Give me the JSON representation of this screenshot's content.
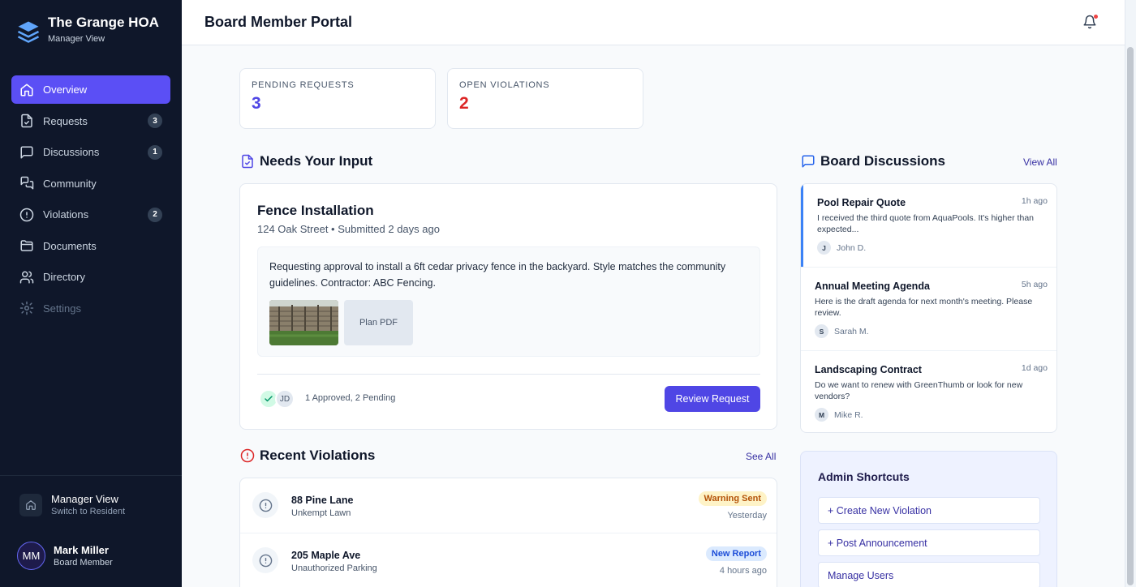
{
  "brand": {
    "name": "The Grange HOA",
    "subtitle": "Manager View"
  },
  "sidebar": {
    "items": [
      {
        "label": "Overview",
        "icon": "home-icon",
        "active": true
      },
      {
        "label": "Requests",
        "icon": "file-check-icon",
        "badge": "3"
      },
      {
        "label": "Discussions",
        "icon": "chat-icon",
        "badge": "1"
      },
      {
        "label": "Community",
        "icon": "messages-icon"
      },
      {
        "label": "Violations",
        "icon": "alert-circle-icon",
        "badge": "2"
      },
      {
        "label": "Documents",
        "icon": "folder-icon"
      },
      {
        "label": "Directory",
        "icon": "users-icon"
      },
      {
        "label": "Settings",
        "icon": "gear-icon",
        "disabled": true
      }
    ],
    "switch_view": {
      "title": "Manager View",
      "subtitle": "Switch to Resident"
    },
    "user": {
      "initials": "MM",
      "name": "Mark Miller",
      "role": "Board Member"
    }
  },
  "header": {
    "title": "Board Member Portal"
  },
  "stats": {
    "pending": {
      "label": "PENDING REQUESTS",
      "value": "3"
    },
    "violations": {
      "label": "OPEN VIOLATIONS",
      "value": "2"
    }
  },
  "needs_input": {
    "heading": "Needs Your Input",
    "request": {
      "title": "Fence Installation",
      "meta": "124 Oak Street • Submitted 2 days ago",
      "description": "Requesting approval to install a 6ft cedar privacy fence in the backyard. Style matches the community guidelines. Contractor: ABC Fencing.",
      "attachment_label": "Plan PDF",
      "voter_initials": "JD",
      "vote_summary": "1 Approved, 2 Pending",
      "review_label": "Review Request"
    }
  },
  "violations": {
    "heading": "Recent Violations",
    "see_all": "See All",
    "items": [
      {
        "address": "88 Pine Lane",
        "type": "Unkempt Lawn",
        "badge": "Warning Sent",
        "time": "Yesterday"
      },
      {
        "address": "205 Maple Ave",
        "type": "Unauthorized Parking",
        "badge": "New Report",
        "time": "4 hours ago"
      }
    ]
  },
  "discussions": {
    "heading": "Board Discussions",
    "view_all": "View All",
    "items": [
      {
        "title": "Pool Repair Quote",
        "time": "1h ago",
        "text": "I received the third quote from AquaPools. It's higher than expected...",
        "initial": "J",
        "author": "John D."
      },
      {
        "title": "Annual Meeting Agenda",
        "time": "5h ago",
        "text": "Here is the draft agenda for next month's meeting. Please review.",
        "initial": "S",
        "author": "Sarah M."
      },
      {
        "title": "Landscaping Contract",
        "time": "1d ago",
        "text": "Do we want to renew with GreenThumb or look for new vendors?",
        "initial": "M",
        "author": "Mike R."
      }
    ]
  },
  "admin": {
    "heading": "Admin Shortcuts",
    "actions": [
      "+ Create New Violation",
      "+ Post Announcement",
      "Manage Users"
    ]
  },
  "colors": {
    "accent": "#5b4ff5",
    "pending_value": "#4f46e5",
    "violation_value": "#dc2626",
    "warning_badge_bg": "#fef3c7",
    "warning_badge_fg": "#b45309",
    "new_badge_bg": "#dbeafe",
    "new_badge_fg": "#1d4ed8"
  }
}
